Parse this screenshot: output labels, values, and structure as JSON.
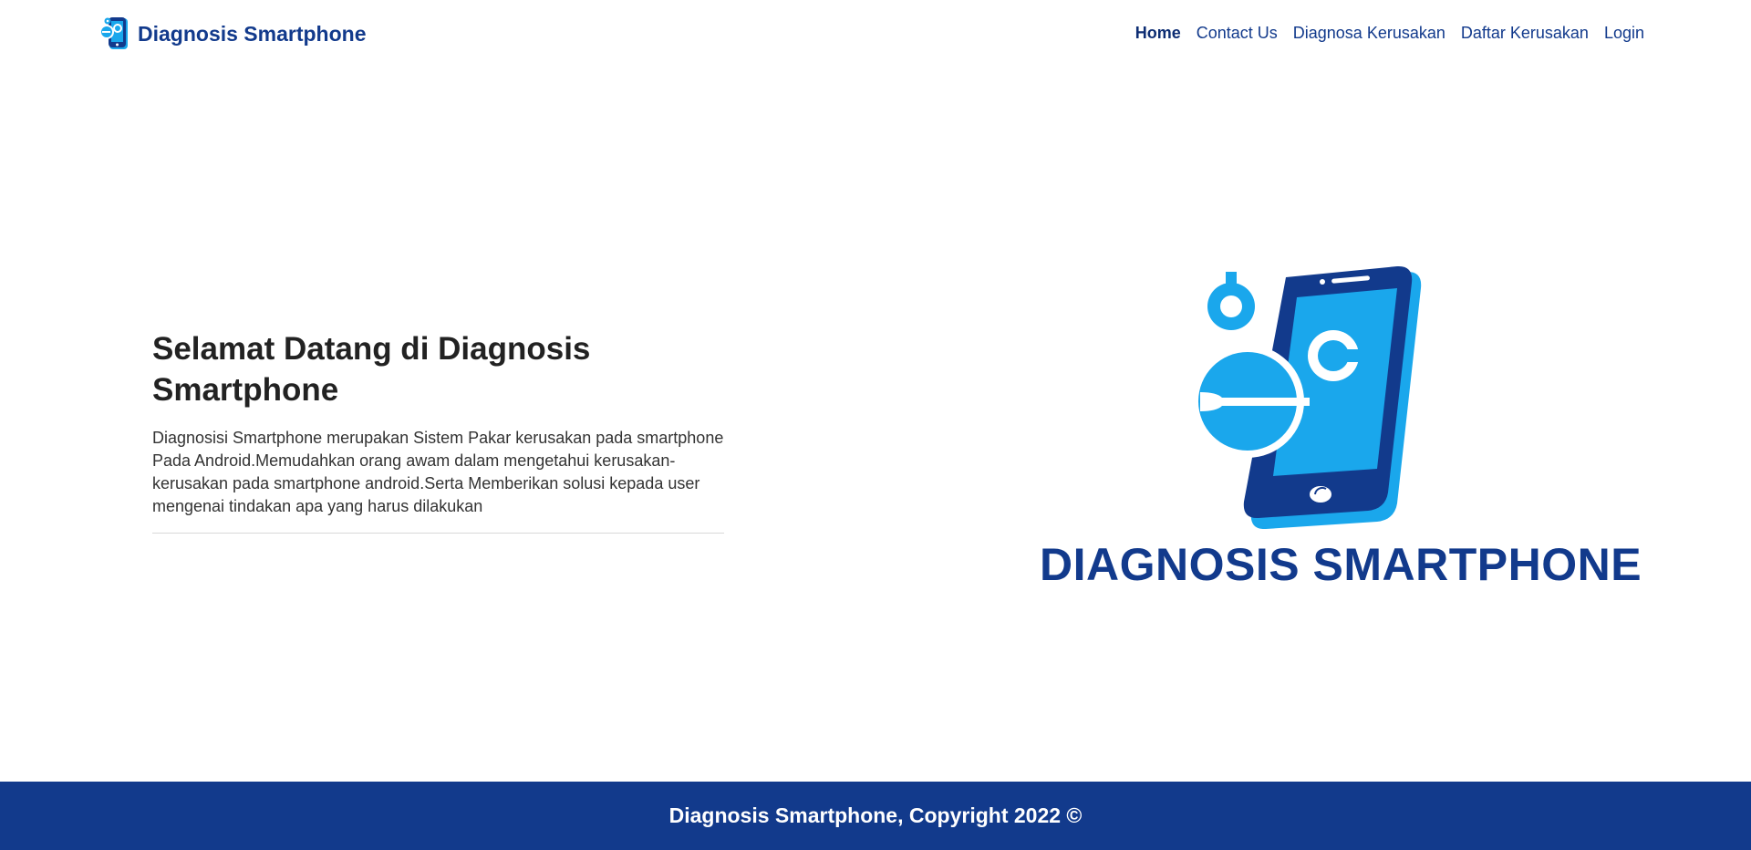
{
  "brand": {
    "name": "Diagnosis Smartphone",
    "logo_icon": "smartphone-repair-icon"
  },
  "nav": {
    "items": [
      {
        "label": "Home",
        "active": true
      },
      {
        "label": "Contact Us",
        "active": false
      },
      {
        "label": "Diagnosa Kerusakan",
        "active": false
      },
      {
        "label": "Daftar Kerusakan",
        "active": false
      },
      {
        "label": "Login",
        "active": false
      }
    ]
  },
  "hero": {
    "title": "Selamat Datang di Diagnosis Smartphone",
    "description": "Diagnosisi Smartphone merupakan Sistem Pakar kerusakan pada smartphone Pada Android.Memudahkan orang awam dalam mengetahui kerusakan-kerusakan pada smartphone android.Serta Memberikan solusi kepada user mengenai tindakan apa yang harus dilakukan",
    "logo_text": "DIAGNOSIS SMARTPHONE"
  },
  "footer": {
    "text": "Diagnosis Smartphone, Copyright 2022 ©"
  },
  "colors": {
    "primary": "#123a8c",
    "accent": "#1aa7ec",
    "footer_bg": "#123a8c"
  }
}
